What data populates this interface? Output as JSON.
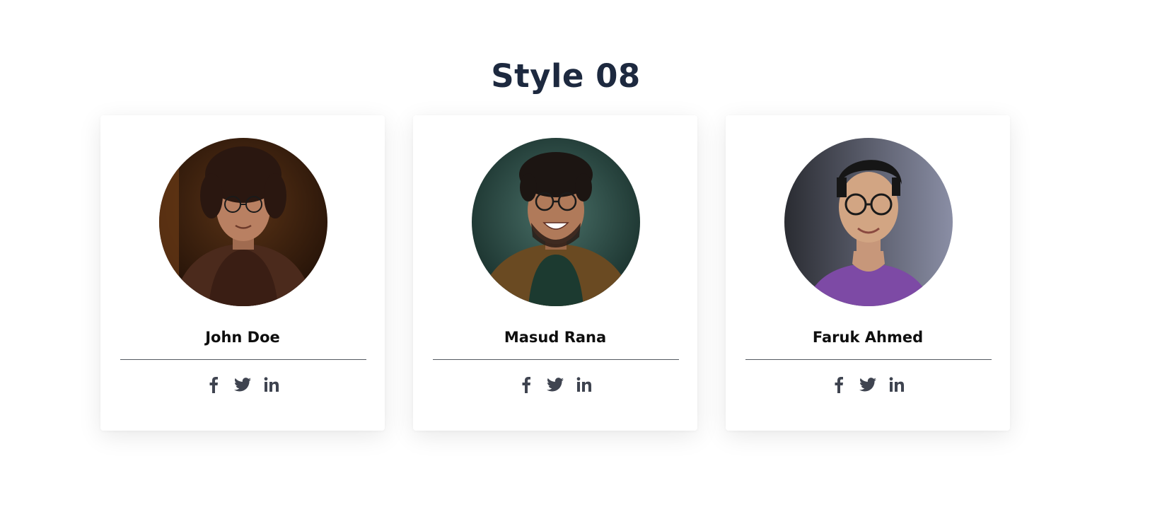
{
  "heading": "Style 08",
  "members": [
    {
      "name": "John Doe",
      "avatar_colors": {
        "bg": "#3a1d0e",
        "skin": "#b98062",
        "hair": "#2a1710",
        "shirt": "#4b2a1c"
      }
    },
    {
      "name": "Masud Rana",
      "avatar_colors": {
        "bg": "#1f3a35",
        "skin": "#b07a5a",
        "hair": "#1c1512",
        "shirt": "#6a4a22"
      }
    },
    {
      "name": "Faruk Ahmed",
      "avatar_colors": {
        "bg": "#4a4d5a",
        "skin": "#d2a583",
        "hair": "#161616",
        "shirt": "#7d4aa5"
      }
    }
  ],
  "social_icons": [
    "facebook-icon",
    "twitter-icon",
    "linkedin-icon"
  ],
  "colors": {
    "heading": "#1d293f",
    "icon": "#3f4450",
    "divider": "#555a62"
  }
}
